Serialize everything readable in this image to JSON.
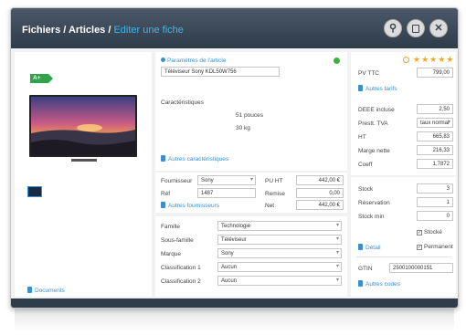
{
  "header": {
    "breadcrumb_root": "Fichiers / Articles / ",
    "breadcrumb_current": "Editer une fiche"
  },
  "left": {
    "energy_label": "A+",
    "documents_label": "Documents"
  },
  "params": {
    "heading": "Paramètres de l'article",
    "name_value": "Téléviseur Sony KDL50W756",
    "characteristics_label": "Caractéristiques",
    "char_size": "51 pouces",
    "char_weight": "30 kg",
    "other_characteristics": "Autres caractéristiques"
  },
  "supplier": {
    "fournisseur_label": "Fournisseur",
    "fournisseur_value": "Sony",
    "ref_label": "Réf",
    "ref_value": "1487",
    "other_suppliers": "Autres fournisseurs",
    "puht_label": "PU HT",
    "puht_value": "442,00 €",
    "remise_label": "Remise",
    "remise_value": "0,00",
    "net_label": "Net",
    "net_value": "442,00 €"
  },
  "classification": {
    "rows": [
      {
        "label": "Famille",
        "value": "Technologie"
      },
      {
        "label": "Sous-famille",
        "value": "Téléviseur"
      },
      {
        "label": "Marque",
        "value": "Sony"
      },
      {
        "label": "Classification 1",
        "value": "Aucun"
      },
      {
        "label": "Classification 2",
        "value": "Aucun"
      }
    ]
  },
  "pricing": {
    "pvttc_label": "PV TTC",
    "pvttc_value": "799,00",
    "other_rates": "Autres tarifs",
    "rows": [
      {
        "label": "DEEE incluse",
        "value": "2,50"
      },
      {
        "label": "Prestt. TVA",
        "value": "taux normal"
      },
      {
        "label": "HT",
        "value": "665,83"
      },
      {
        "label": "Marge nette",
        "value": "216,33"
      },
      {
        "label": "Coeff",
        "value": "1,7872"
      }
    ]
  },
  "stock": {
    "rows": [
      {
        "label": "Stock",
        "value": "3"
      },
      {
        "label": "Réservation",
        "value": "1"
      },
      {
        "label": "Stock min",
        "value": "0"
      }
    ],
    "detail_label": "Détail",
    "stocke_label": "Stocké",
    "permanent_label": "Permanent",
    "gtin_label": "GTIN",
    "gtin_value": "2500100000151",
    "other_codes": "Autres codes"
  },
  "rating": {
    "stars": 5
  },
  "colors": {
    "status_dot": "#3db13d",
    "energy": "#2fa44a",
    "accent": "#3fb7ea",
    "star": "#f5a623"
  }
}
